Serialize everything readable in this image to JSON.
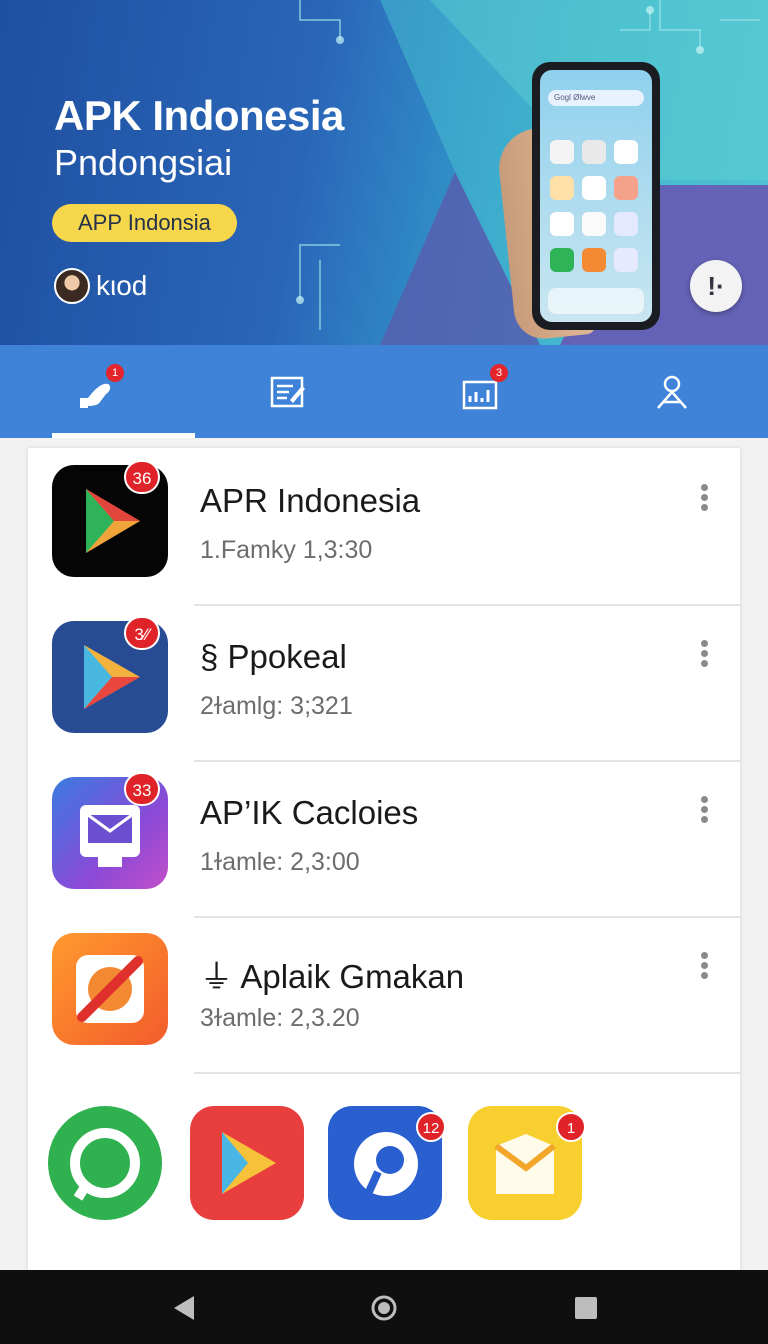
{
  "hero": {
    "title": "APK Indonesia",
    "subtitle": "Pndongsiai",
    "pill_label": "APP Indonsia",
    "user_name": "kιod",
    "phone_search_text": "Goɡl Ølwve",
    "fab_label": "!·",
    "colors": {
      "pill": "#f6d64a",
      "banner_dark": "#1f4fa0",
      "banner_light": "#5ccdd0"
    }
  },
  "tabs": [
    {
      "icon": "hands-icon",
      "badge": "1",
      "selected": true
    },
    {
      "icon": "edit-note-icon",
      "badge": ""
    },
    {
      "icon": "chart-icon",
      "badge": "3"
    },
    {
      "icon": "person-icon",
      "badge": ""
    }
  ],
  "list": {
    "items": [
      {
        "title": "APR Indonesia",
        "meta": "1.Famky  1,3:30",
        "badge": "36",
        "icon": "play-store-icon-dark"
      },
      {
        "title": "§ Ppokeal",
        "meta": "2ɫamlg: 3;321",
        "badge": "3⁄⁄",
        "icon": "play-store-icon-blue"
      },
      {
        "title": "AP’IK Cacloies",
        "meta": "1ɫamle: 2,3:00",
        "badge": "33",
        "icon": "message-icon"
      },
      {
        "title": "⏚ Aplaik Gmakan",
        "meta": "3ɫamle: 2,3.20",
        "badge": "",
        "icon": "no-camera-icon"
      }
    ],
    "apps": [
      {
        "icon": "whatsapp-icon",
        "badge": ""
      },
      {
        "icon": "play-icon",
        "badge": ""
      },
      {
        "icon": "chat-icon",
        "badge": "12"
      },
      {
        "icon": "mail-icon",
        "badge": "1"
      }
    ]
  },
  "navbar": {
    "back": "back-icon",
    "home": "home-icon",
    "recents": "recents-icon"
  }
}
